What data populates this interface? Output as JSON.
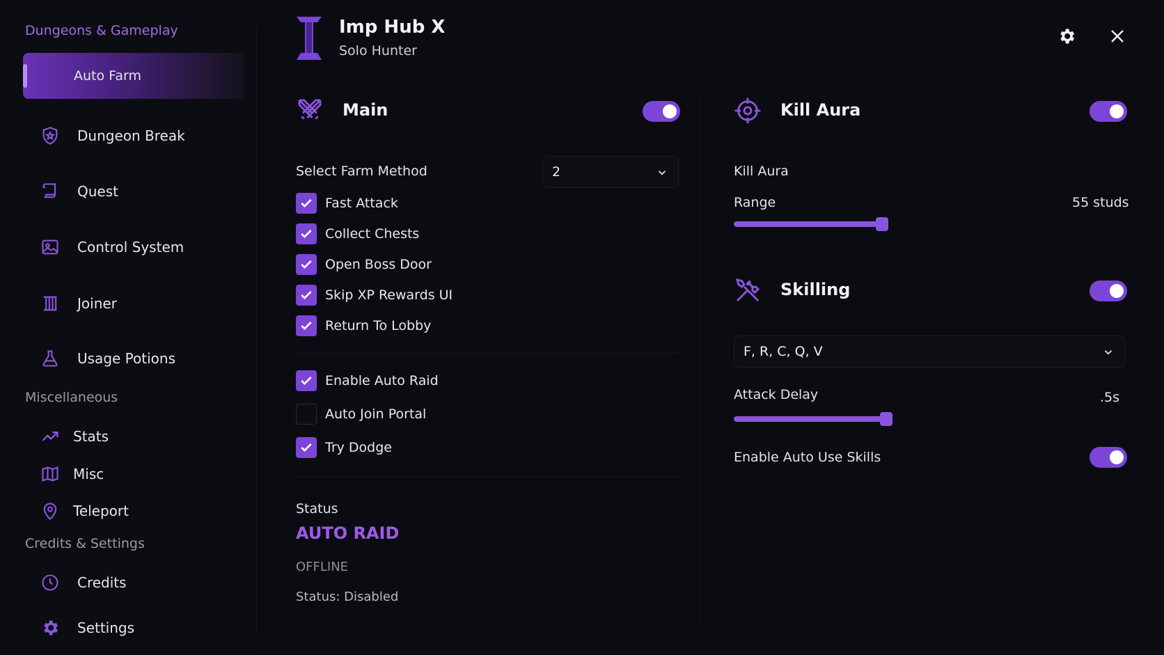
{
  "app": {
    "title": "Imp Hub X",
    "subtitle": "Solo Hunter"
  },
  "colors": {
    "accent": "#7b45d8",
    "accent_text": "#a269e8",
    "background": "#0b0c11"
  },
  "sidebar": {
    "sections": [
      {
        "title": "Dungeons & Gameplay"
      },
      {
        "title": "Miscellaneous"
      },
      {
        "title": "Credits & Settings"
      }
    ],
    "items": [
      {
        "label": "Auto Farm",
        "icon": "auto-farm-icon",
        "active": true
      },
      {
        "label": "Dungeon Break",
        "icon": "shield-icon"
      },
      {
        "label": "Quest",
        "icon": "scroll-icon"
      },
      {
        "label": "Control System",
        "icon": "image-control-icon"
      },
      {
        "label": "Joiner",
        "icon": "pillars-icon"
      },
      {
        "label": "Usage Potions",
        "icon": "flask-icon"
      },
      {
        "label": "Stats",
        "icon": "trend-up-icon"
      },
      {
        "label": "Misc",
        "icon": "map-icon"
      },
      {
        "label": "Teleport",
        "icon": "location-pin-icon"
      },
      {
        "label": "Credits",
        "icon": "clock-icon"
      },
      {
        "label": "Settings",
        "icon": "gear-icon"
      }
    ]
  },
  "main": {
    "title": "Main",
    "enabled": true,
    "farm_method": {
      "label": "Select Farm Method",
      "value": "2"
    },
    "checks_group1": [
      {
        "label": "Fast Attack",
        "checked": true
      },
      {
        "label": "Collect Chests",
        "checked": true
      },
      {
        "label": "Open Boss Door",
        "checked": true
      },
      {
        "label": "Skip XP Rewards UI",
        "checked": true
      },
      {
        "label": "Return To Lobby",
        "checked": true
      }
    ],
    "checks_group2": [
      {
        "label": "Enable Auto Raid",
        "checked": true
      },
      {
        "label": "Auto Join Portal",
        "checked": false
      },
      {
        "label": "Try Dodge",
        "checked": true
      }
    ],
    "status": {
      "heading": "Status",
      "mode": "AUTO RAID",
      "state": "OFFLINE",
      "detail": "Status: Disabled"
    }
  },
  "kill_aura": {
    "title": "Kill Aura",
    "enabled": true,
    "label": "Kill Aura",
    "range_label": "Range",
    "range_value": "55 studs",
    "range_fraction": 0.37
  },
  "skilling": {
    "title": "Skilling",
    "enabled": true,
    "skills_value": "F, R, C, Q, V",
    "attack_delay_label": "Attack Delay",
    "attack_delay_value": ".5s",
    "attack_delay_fraction": 0.38,
    "auto_skills_label": "Enable Auto Use Skills",
    "auto_skills_enabled": true
  }
}
